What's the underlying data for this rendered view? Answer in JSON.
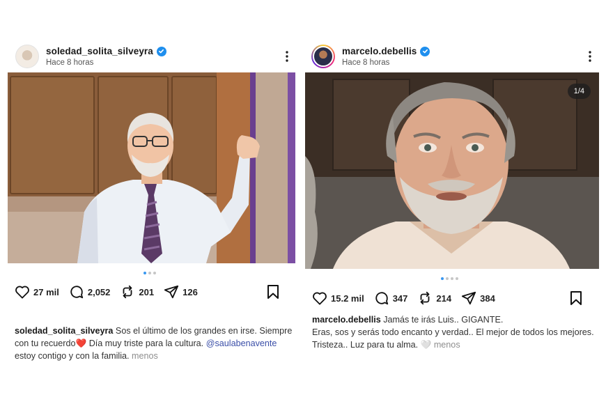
{
  "posts": [
    {
      "username": "soledad_solita_silveyra",
      "timestamp": "Hace 8 horas",
      "likes": "27 mil",
      "comments": "2,052",
      "reposts": "201",
      "shares": "126",
      "caption": {
        "username": "soledad_solita_silveyra",
        "text_part1": "Sos el último de los grandes en irse. Siempre con tu recuerdo",
        "emoji": "❤️",
        "text_part2": "Día muy triste para la cultura.",
        "mention": "@saulabenavente",
        "text_part3": "estoy contigo y con la familia.",
        "more": "menos"
      },
      "carousel": {
        "current": 1,
        "total": 3
      }
    },
    {
      "username": "marcelo.debellis",
      "timestamp": "Hace 8 horas",
      "image_counter": "1/4",
      "likes": "15.2 mil",
      "comments": "347",
      "reposts": "214",
      "shares": "384",
      "caption": {
        "username": "marcelo.debellis",
        "text_part1": "Jamás te irás Luis.. GIGANTE.",
        "text_part2": "Eras, sos y serás todo encanto y verdad.. El mejor de todos los mejores. Tristeza.. Luz para tu alma.",
        "emoji": "🤍",
        "more": "menos"
      },
      "carousel": {
        "current": 1,
        "total": 4
      }
    }
  ],
  "icons": {
    "like": "heart-outline-icon",
    "comment": "speech-bubble-icon",
    "repost": "repost-arrows-icon",
    "share": "paper-plane-icon",
    "save": "bookmark-icon",
    "verified": "verified-badge-icon",
    "more": "more-vertical-icon"
  },
  "colors": {
    "verified": "#1f8fee",
    "mention": "#3b4fa8",
    "muted": "#8e8e8e",
    "dot_active": "#3897f0"
  }
}
